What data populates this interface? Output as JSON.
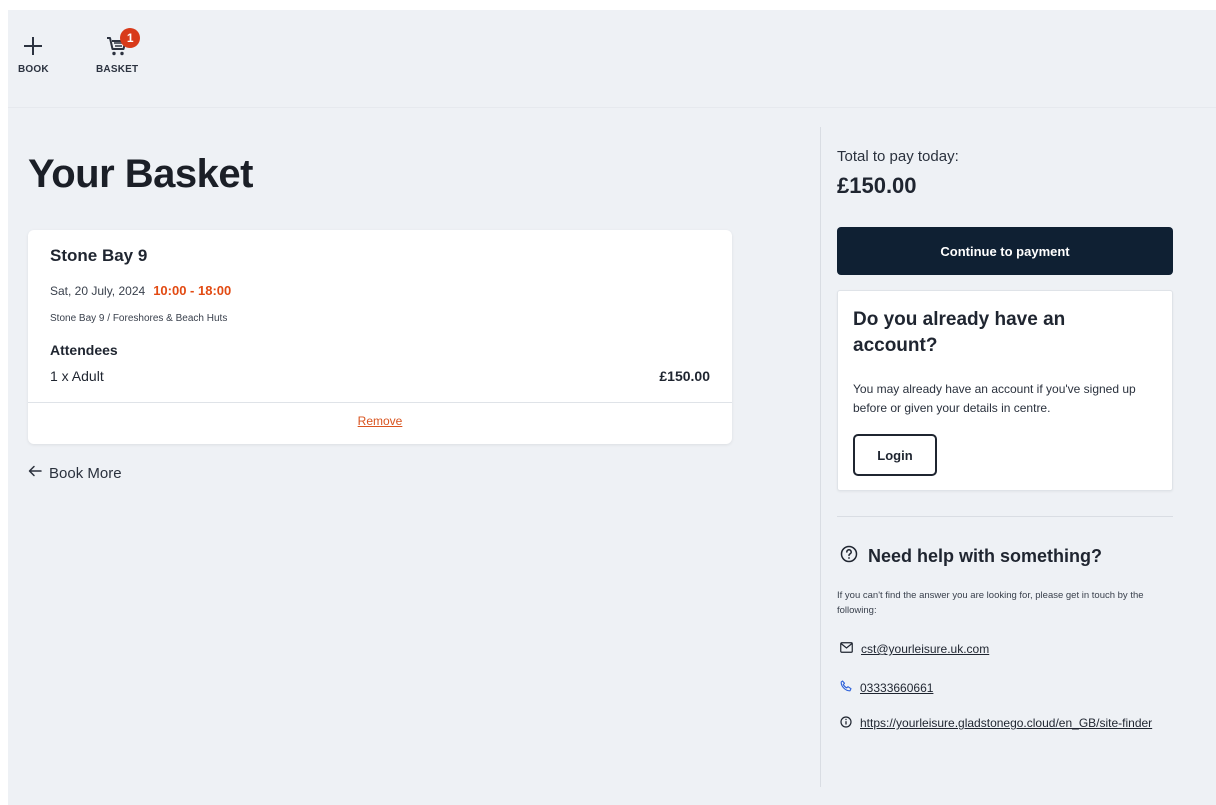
{
  "nav": {
    "book_label": "BOOK",
    "basket_label": "BASKET",
    "basket_count": "1"
  },
  "page": {
    "title": "Your Basket"
  },
  "basket_item": {
    "title": "Stone Bay 9",
    "date": "Sat, 20 July, 2024",
    "time": "10:00 - 18:00",
    "location": "Stone Bay 9 / Foreshores & Beach Huts",
    "attendees_heading": "Attendees",
    "attendees": [
      {
        "label": "1 x Adult",
        "price": "£150.00"
      }
    ],
    "remove_label": "Remove"
  },
  "book_more_label": "Book More",
  "summary": {
    "total_label": "Total to pay today:",
    "total_amount": "£150.00",
    "continue_label": "Continue to payment"
  },
  "account": {
    "title": "Do you already have an account?",
    "text": "You may already have an account if you've signed up before or given your details in centre.",
    "login_label": "Login"
  },
  "help": {
    "title": "Need help with something?",
    "text": "If you can't find the answer you are looking for, please get in touch by the following:",
    "email": "cst@yourleisure.uk.com",
    "phone": "03333660661",
    "website": "https://yourleisure.gladstonego.cloud/en_GB/site-finder"
  },
  "colors": {
    "background": "#eef1f5",
    "primary_button": "#0f2033",
    "accent_time": "#e24a12",
    "badge": "#d83a1a",
    "remove_link": "#d9541f"
  },
  "icons": {
    "book": "plus-icon",
    "basket": "cart-icon",
    "back": "arrow-left-icon",
    "help": "question-circle-icon",
    "email": "envelope-icon",
    "phone": "phone-icon",
    "web": "info-circle-icon"
  }
}
